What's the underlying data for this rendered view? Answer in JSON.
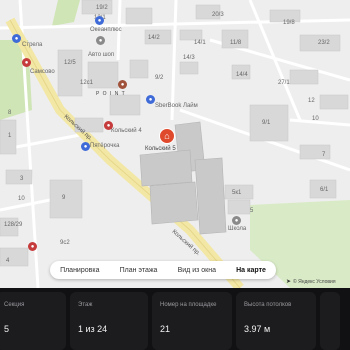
{
  "map": {
    "labels": {
      "ocean_plus": "Океанплюс",
      "avto_shop": "Авто шоп",
      "strela": "Стрела",
      "samsovo": "Самсово",
      "point": "P O I N T",
      "sbi": "SberBook Лайм",
      "kolsky4": "Кольский 4",
      "pyaterochka": "Пятёрочка",
      "kolsky5": "Кольский 5",
      "school": "Школа",
      "street1": "Кольский пр.",
      "street2": "Кольский пр.",
      "n_19_2": "19/2",
      "n_12a": "12/1",
      "n_14_2": "14/2",
      "n_14_1": "14/1",
      "n_14_3": "14/3",
      "n_20_3": "20/3",
      "n_12c1": "12с1",
      "n_9_2": "9/2",
      "n_11_8": "11/8",
      "n_19_8": "19/8",
      "n_27_1": "27/1",
      "n_23_2": "23/2",
      "n_14_4": "14/4",
      "n_12b": "12/5",
      "n_10": "10",
      "n_12": "12",
      "n_7": "7",
      "n_9_1": "9/1",
      "n_6b": "6/1",
      "n_5k1": "5к1",
      "n_5": "5",
      "n_4": "4",
      "n_1": "1",
      "n_3": "3",
      "n_128_29": "128/29",
      "n_9": "9",
      "n_10b": "10",
      "n_9c2": "9с2",
      "n_8": "8"
    },
    "tabs": [
      "Планировка",
      "План этажа",
      "Вид из окна",
      "На карте"
    ],
    "active_tab": "На карте",
    "attribution": "© Яндекс Условия"
  },
  "stats": [
    {
      "label": "Секция",
      "value": "5"
    },
    {
      "label": "Этаж",
      "value": "1 из 24"
    },
    {
      "label": "Номер на площадке",
      "value": "21"
    },
    {
      "label": "Высота потолков",
      "value": "3.97 м"
    },
    {
      "label": "",
      "value": ""
    }
  ],
  "colors": {
    "map_bg": "#eeeeee",
    "building": "#d6d6d6",
    "road": "#ffffff",
    "main_road": "#f3e7a6",
    "park": "#cfe5b5",
    "panel_bg": "#111113",
    "card_bg": "#1c1c1f",
    "home_pin": "#e04a2c"
  },
  "icons": [
    "home-pin-icon",
    "bus-stop-icon",
    "school-icon",
    "shop-icon",
    "yandex-arrow-icon"
  ]
}
